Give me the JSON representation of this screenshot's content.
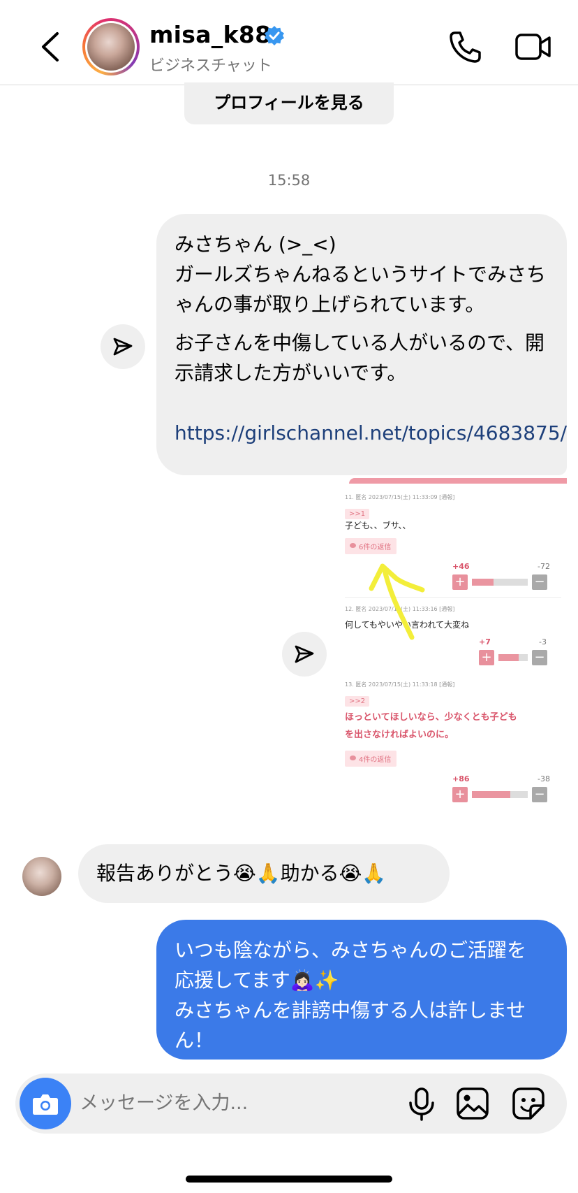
{
  "header": {
    "username": "misa_k88",
    "subtitle": "ビジネスチャット",
    "verified": true
  },
  "profile_button": {
    "label": "プロフィールを見る"
  },
  "timestamp": "15:58",
  "messages": {
    "outgoing_1": {
      "line1": "みさちゃん (>_<)",
      "line2": "ガールズちゃんねるというサイトでみさちゃんの事が取り上げられています。",
      "line3": "お子さんを中傷している人がいるので、開示請求した方がいいです。",
      "link": "https://girlschannel.net/topics/4683875/"
    },
    "screenshot": {
      "c11_meta": "11. 匿名 2023/07/15(土) 11:33:09 [通報]",
      "c11_anchor": ">>1",
      "c11_text": "子ども、、ブサ、、",
      "c11_replies": "6件の返信",
      "c11_plus": "+46",
      "c11_minus": "-72",
      "c11_ratio": 0.39,
      "c12_meta": "12. 匿名 2023/07/15(土) 11:33:16 [通報]",
      "c12_text": "何してもやいやい言われて大変ね",
      "c12_plus": "+7",
      "c12_minus": "-3",
      "c12_ratio": 0.7,
      "c13_meta": "13. 匿名 2023/07/15(土) 11:33:18 [通報]",
      "c13_anchor": ">>2",
      "c13_text1": "ほっといてほしいなら、少なくとも子ども",
      "c13_text2": "を出さなければよいのに。",
      "c13_replies": "4件の返信",
      "c13_plus": "+86",
      "c13_minus": "-38",
      "c13_ratio": 0.69
    },
    "incoming_1": {
      "text": "報告ありがとう😭🙏助かる😭🙏"
    },
    "outgoing_2": {
      "line1": "いつも陰ながら、みさちゃんのご活躍を",
      "line2": "応援してます🙇🏻‍♀️✨",
      "line3": "みさちゃんを誹謗中傷する人は許しません！"
    }
  },
  "composer": {
    "placeholder": "メッセージを入力..."
  },
  "colors": {
    "outgoing_bubble": "#3b7ae8",
    "incoming_bubble": "#efefef",
    "camera_button": "#3b82f6",
    "accent_pink": "#e8909c"
  },
  "icons": [
    "back-icon",
    "verified-badge-icon",
    "phone-icon",
    "video-icon",
    "share-icon",
    "camera-icon",
    "mic-icon",
    "gallery-icon",
    "sticker-icon"
  ]
}
